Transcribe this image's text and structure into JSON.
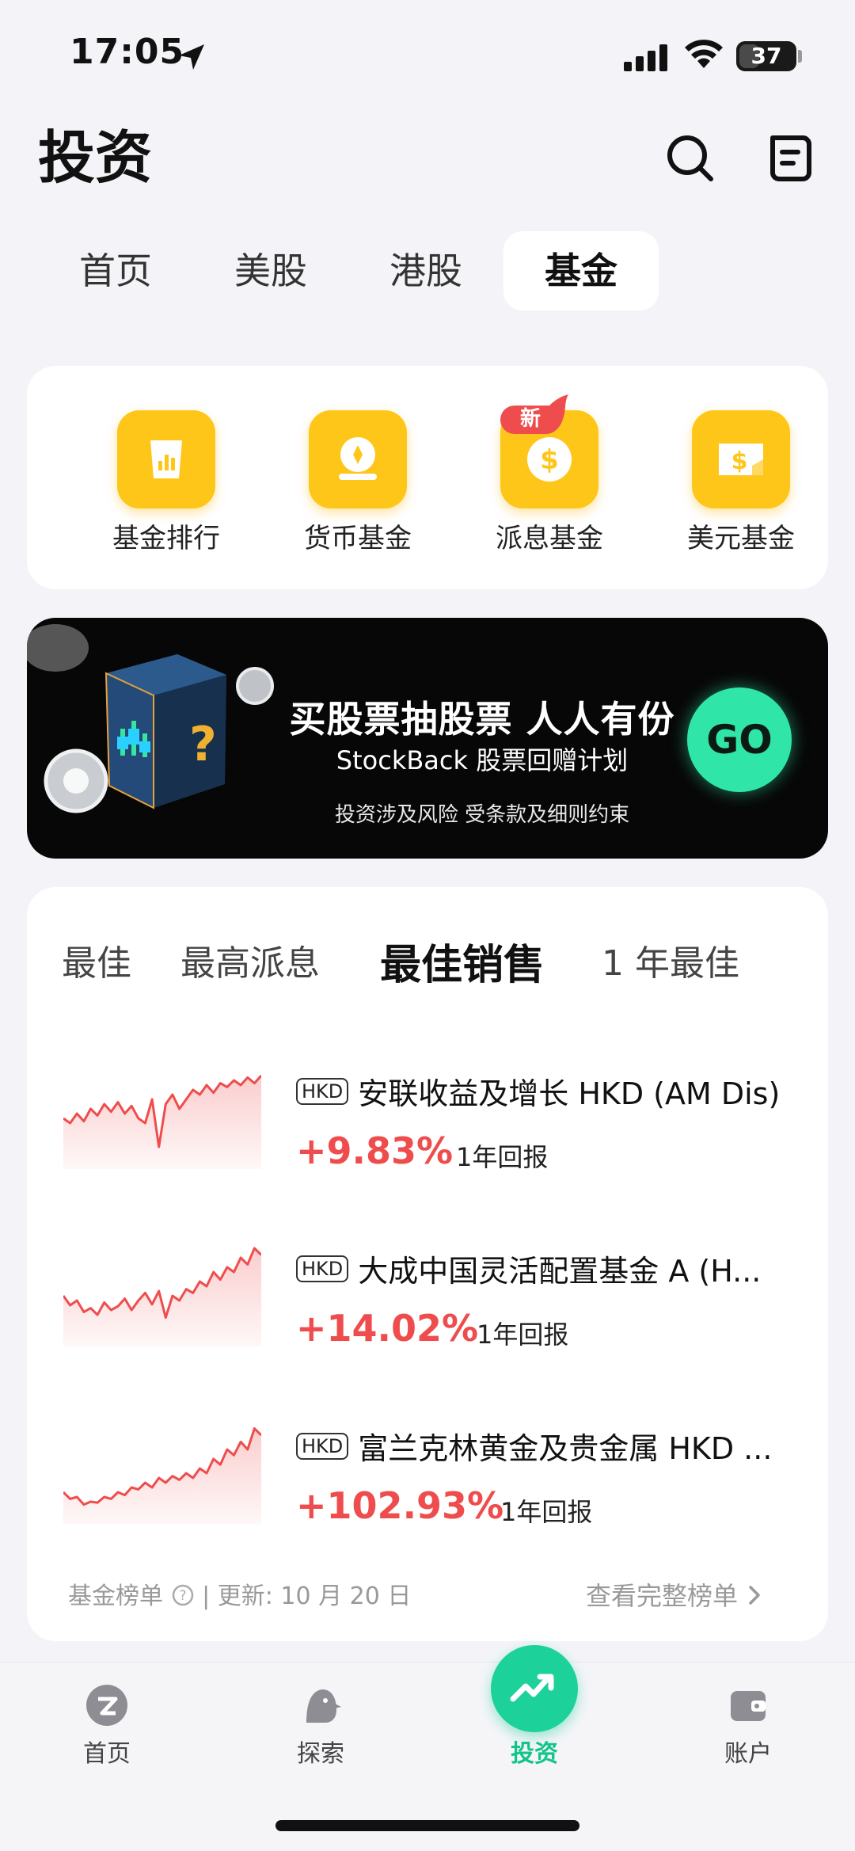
{
  "status_bar": {
    "time": "17:05",
    "battery": "37",
    "battery_level": 0.37
  },
  "header": {
    "title": "投资"
  },
  "top_tabs": [
    {
      "label": "首页",
      "active": false
    },
    {
      "label": "美股",
      "active": false
    },
    {
      "label": "港股",
      "active": false
    },
    {
      "label": "基金",
      "active": true
    }
  ],
  "quick_links": [
    {
      "label": "基金排行",
      "icon": "chart-icon"
    },
    {
      "label": "货币基金",
      "icon": "coin-icon"
    },
    {
      "label": "派息基金",
      "icon": "dollar-icon"
    },
    {
      "label": "美元基金",
      "icon": "dollar-bill-icon"
    }
  ],
  "new_badge": "新",
  "banner": {
    "title": "买股票抽股票 人人有份",
    "subtitle": "StockBack 股票回赠计划",
    "note": "投资涉及风险 受条款及细则约束",
    "button": "GO"
  },
  "fund_tabs": [
    {
      "label": "最佳",
      "active": false
    },
    {
      "label": "最高派息",
      "active": false
    },
    {
      "label": "最佳销售",
      "active": true
    },
    {
      "label": "1 年最佳",
      "active": false
    }
  ],
  "funds": [
    {
      "currency": "HKD",
      "name": "安联收益及增长 HKD (AM Dis)",
      "return": "+9.83%",
      "return_label": "1年回报",
      "spark": [
        0.55,
        0.6,
        0.5,
        0.58,
        0.45,
        0.52,
        0.4,
        0.48,
        0.38,
        0.5,
        0.42,
        0.55,
        0.6,
        0.35,
        0.85,
        0.4,
        0.3,
        0.45,
        0.35,
        0.25,
        0.3,
        0.2,
        0.28,
        0.18,
        0.22,
        0.15,
        0.2,
        0.12,
        0.18,
        0.1
      ]
    },
    {
      "currency": "HKD",
      "name": "大成中国灵活配置基金 A (H...",
      "return": "+14.02%",
      "return_label": "1年回报",
      "spark": [
        0.55,
        0.65,
        0.6,
        0.72,
        0.68,
        0.75,
        0.62,
        0.7,
        0.66,
        0.58,
        0.7,
        0.6,
        0.52,
        0.64,
        0.5,
        0.78,
        0.55,
        0.6,
        0.48,
        0.52,
        0.4,
        0.45,
        0.3,
        0.38,
        0.25,
        0.3,
        0.15,
        0.22,
        0.05,
        0.12
      ]
    },
    {
      "currency": "HKD",
      "name": "富兰克林黄金及贵金属 HKD ...",
      "return": "+102.93%",
      "return_label": "1年回报",
      "spark": [
        0.75,
        0.82,
        0.8,
        0.88,
        0.85,
        0.86,
        0.8,
        0.82,
        0.75,
        0.78,
        0.7,
        0.72,
        0.65,
        0.7,
        0.6,
        0.65,
        0.58,
        0.62,
        0.55,
        0.6,
        0.5,
        0.55,
        0.4,
        0.46,
        0.3,
        0.36,
        0.22,
        0.3,
        0.08,
        0.15
      ]
    }
  ],
  "footer": {
    "left_label": "基金榜单",
    "updated": "| 更新: 10 月 20 日",
    "right_link": "查看完整榜单"
  },
  "bottom_nav": [
    {
      "label": "首页",
      "icon": "home-logo-icon",
      "active": false
    },
    {
      "label": "探索",
      "icon": "bird-icon",
      "active": false
    },
    {
      "label": "投资",
      "icon": "trend-icon",
      "active": true
    },
    {
      "label": "账户",
      "icon": "wallet-icon",
      "active": false
    }
  ],
  "colors": {
    "accent": "#1dd19a",
    "positive": "#ef4d4d",
    "quick_icon": "#ffc61a",
    "go_button": "#2fe6a8"
  }
}
